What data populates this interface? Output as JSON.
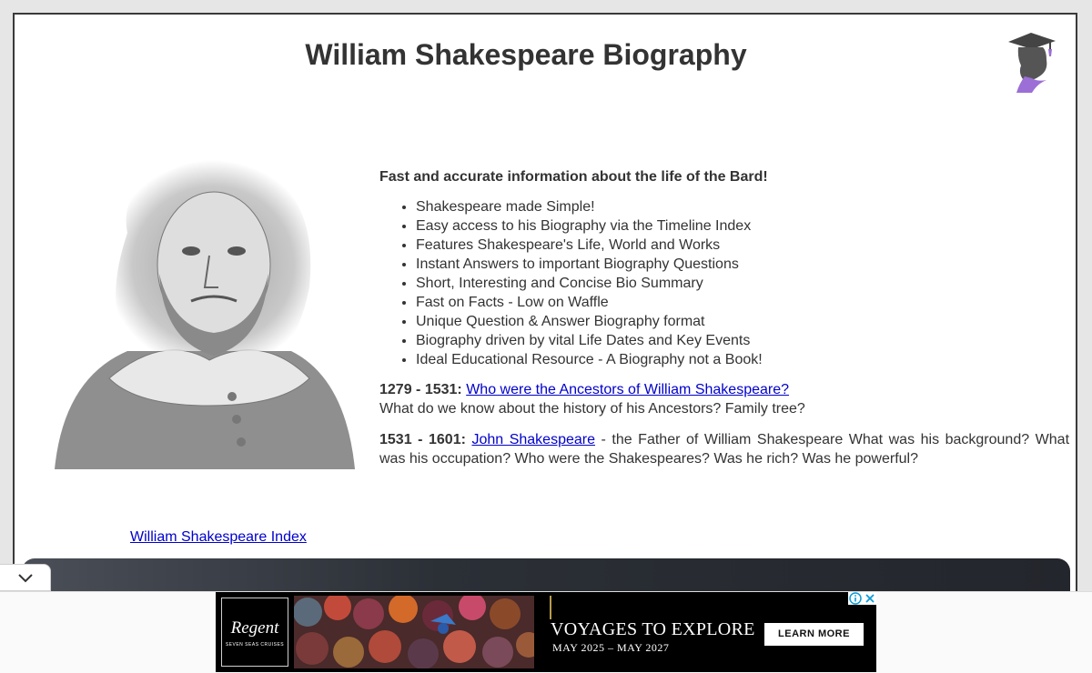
{
  "page": {
    "title": "William Shakespeare Biography",
    "tagline": "Fast and accurate information about the life of the Bard!",
    "features": [
      "Shakespeare made Simple!",
      "Easy access to his Biography via the Timeline Index",
      "Features Shakespeare's Life, World and Works",
      "Instant Answers to important Biography Questions",
      "Short, Interesting and Concise Bio Summary",
      "Fast on Facts - Low on Waffle",
      "Unique Question & Answer Biography format",
      "Biography driven by vital Life Dates and Key Events",
      "Ideal Educational Resource - A Biography not a Book!"
    ],
    "entries": [
      {
        "dates": "1279 - 1531:",
        "link": "Who were the Ancestors of William Shakespeare?",
        "text": "What do we know about the history of his Ancestors? Family tree?"
      },
      {
        "dates": "1531 - 1601:",
        "link": "John Shakespeare",
        "text": " - the Father of William Shakespeare What was his background? What was his occupation? Who were the Shakespeares? Was he rich? Was he powerful?"
      }
    ],
    "index_link": "William Shakespeare Index"
  },
  "icons": {
    "logo": "graduate-silhouette-icon",
    "collapse": "chevron-down-icon",
    "ad_info": "info-icon",
    "ad_close": "close-icon"
  },
  "ad": {
    "brand": "Regent",
    "brand_sub": "SEVEN SEAS CRUISES",
    "headline": "VOYAGES TO EXPLORE",
    "dates": "MAY 2025 – MAY 2027",
    "cta": "LEARN MORE"
  },
  "colors": {
    "link": "#0000cc",
    "text": "#333333",
    "logo_accent": "#9b6fd6",
    "footer_bar": "#2b2f36"
  }
}
